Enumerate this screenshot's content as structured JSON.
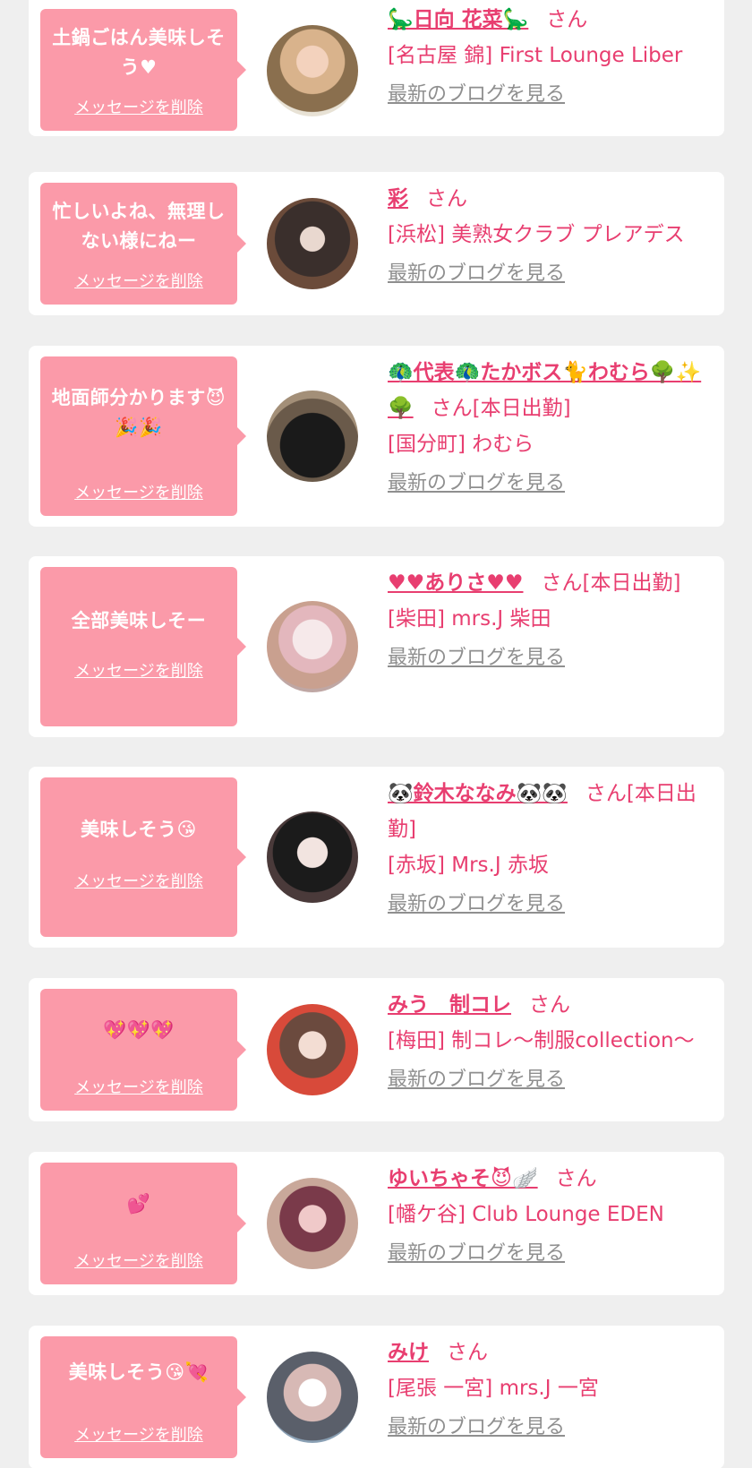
{
  "delete_label": "メッセージを削除",
  "blog_label": "最新のブログを見る",
  "san_label": "さん",
  "colors": {
    "bubble": "#fb9aa9",
    "name": "#e83e70",
    "link_gray": "#8f8f8f",
    "background": "#efefef"
  },
  "messages": [
    {
      "text": "土鍋ごはん美味しそう♥",
      "name": "🦕日向 花菜🦕",
      "suffix": "さん",
      "shop": "[名古屋 錦] First Lounge Liber"
    },
    {
      "text": "忙しいよね、無理しない様にねー",
      "name": "彩",
      "suffix": "さん",
      "shop": "[浜松] 美熟女クラブ プレアデス"
    },
    {
      "text": "地面師分かります😈🎉🎉",
      "name": "🦚代表🦚たかボス🐈わむら🌳✨🌳",
      "suffix": "さん[本日出勤]",
      "shop": "[国分町] わむら"
    },
    {
      "text": "全部美味しそー",
      "name": "♥♥ありさ♥♥",
      "suffix": "さん[本日出勤]",
      "shop": "[柴田] mrs.J 柴田"
    },
    {
      "text": "美味しそう😘",
      "name": "🐼鈴木ななみ🐼🐼",
      "suffix": "さん[本日出勤]",
      "shop": "[赤坂] Mrs.J 赤坂"
    },
    {
      "text": "💖💖💖",
      "name": "みう　制コレ",
      "suffix": "さん",
      "shop": "[梅田] 制コレ〜制服collection〜"
    },
    {
      "text": "💕",
      "name": "ゆいちゃそ😈🪽",
      "suffix": "さん",
      "shop": "[幡ケ谷] Club Lounge EDEN"
    },
    {
      "text": "美味しそう😘💘",
      "name": "みけ",
      "suffix": "さん",
      "shop": "[尾張 一宮] mrs.J 一宮"
    }
  ]
}
